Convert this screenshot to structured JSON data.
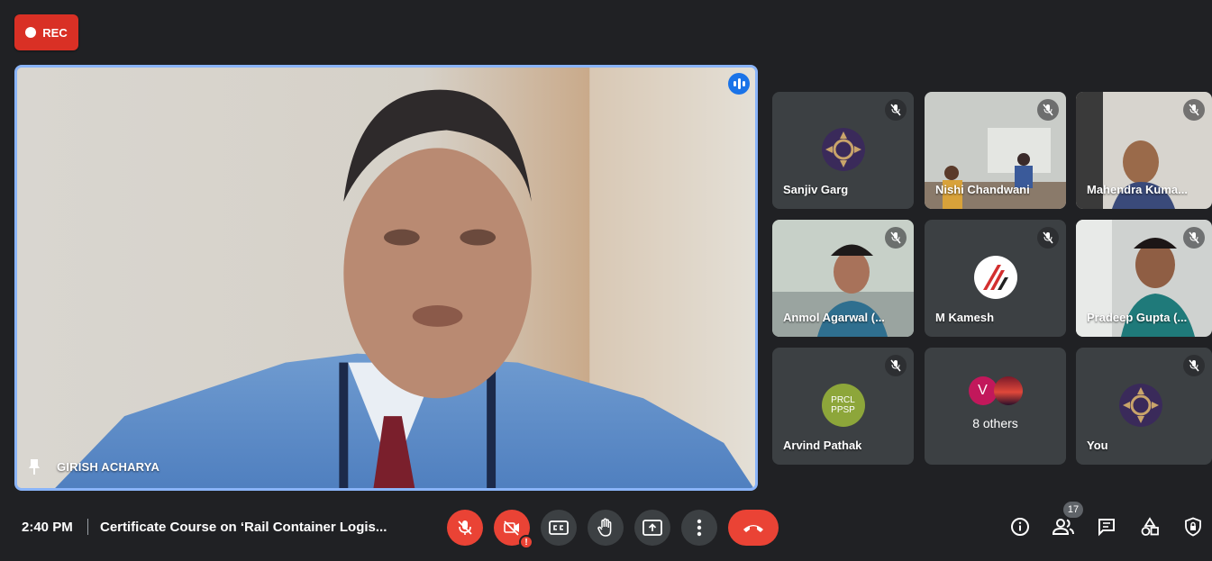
{
  "recording": {
    "label": "REC"
  },
  "main": {
    "name": "GIRISH ACHARYA"
  },
  "participants": [
    {
      "name": "Sanjiv Garg"
    },
    {
      "name": "Nishi Chandwani"
    },
    {
      "name": "Mahendra Kuma..."
    },
    {
      "name": "Anmol Agarwal (..."
    },
    {
      "name": "M Kamesh"
    },
    {
      "name": "Pradeep Gupta (..."
    },
    {
      "name": "Arvind Pathak",
      "avatar_text": [
        "PRCL",
        "PPSP"
      ]
    },
    {
      "name": "8 others",
      "avatar_initial": "V"
    },
    {
      "name": "You"
    }
  ],
  "bottom": {
    "time": "2:40 PM",
    "title": "Certificate Course on ‘Rail Container Logis...",
    "people_count": "17",
    "camera_warning": "!"
  },
  "colors": {
    "accent": "#8ab4f8",
    "danger": "#ea4335",
    "tile": "#3c4043",
    "background": "#202124"
  }
}
